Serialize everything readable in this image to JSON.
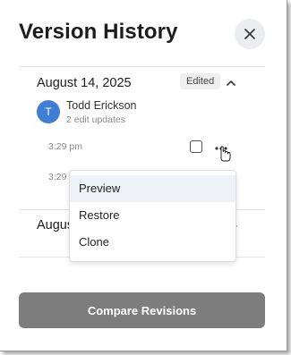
{
  "header": {
    "title": "Version History",
    "close_icon": "close-icon"
  },
  "entry1": {
    "date": "August 14, 2025",
    "badge": "Edited",
    "toggle_icon": "chevron-up-icon",
    "user": {
      "initial": "T",
      "name": "Todd Erickson",
      "sub": "2 edit updates",
      "avatar_color": "#3f7fd6"
    },
    "updates": [
      {
        "time": "3:29 pm"
      },
      {
        "time": "3:29"
      }
    ]
  },
  "entry2": {
    "date": "August",
    "toggle_icon": "chevron-down-icon"
  },
  "context_menu": {
    "items": [
      {
        "label": "Preview"
      },
      {
        "label": "Restore"
      },
      {
        "label": "Clone"
      }
    ]
  },
  "footer": {
    "compare_label": "Compare Revisions",
    "compare_color": "#7d7d7d"
  }
}
